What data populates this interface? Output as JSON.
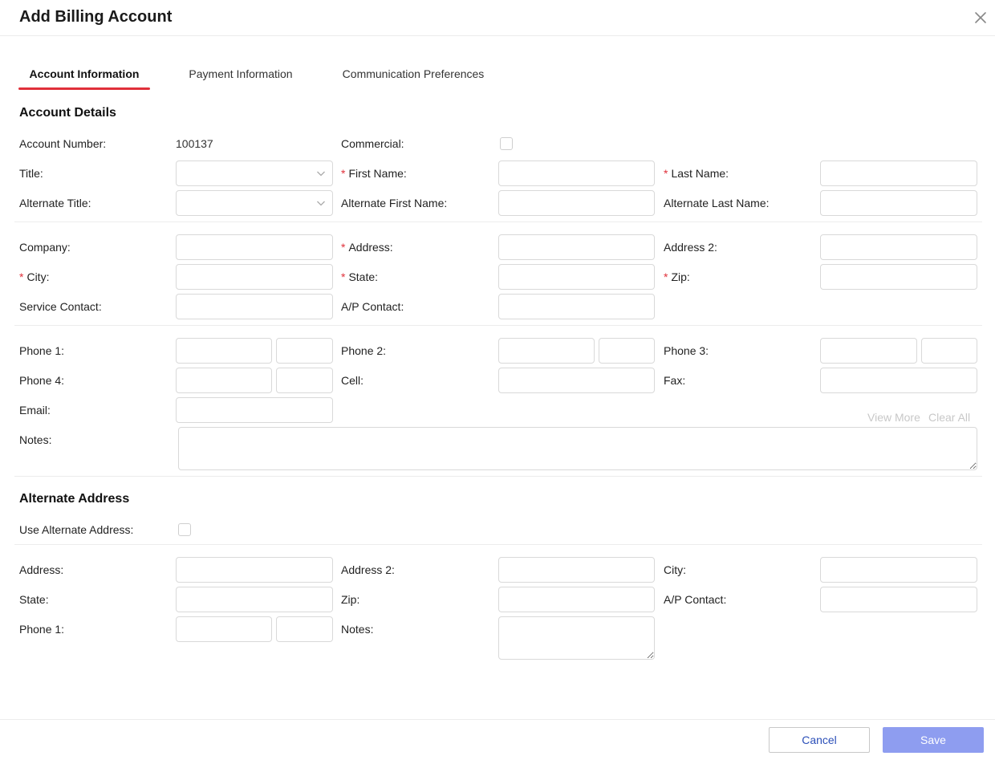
{
  "dialog": {
    "title": "Add Billing Account"
  },
  "tabs": [
    {
      "label": "Account Information",
      "active": true
    },
    {
      "label": "Payment Information",
      "active": false
    },
    {
      "label": "Communication Preferences",
      "active": false
    }
  ],
  "account_details": {
    "section_title": "Account Details",
    "account_number_label": "Account Number:",
    "account_number_value": "100137",
    "commercial_label": "Commercial:",
    "title_label": "Title:",
    "first_name_label": "First Name:",
    "last_name_label": "Last Name:",
    "alt_title_label": "Alternate Title:",
    "alt_first_name_label": "Alternate First Name:",
    "alt_last_name_label": "Alternate Last Name:",
    "company_label": "Company:",
    "address_label": "Address:",
    "address2_label": "Address 2:",
    "city_label": "City:",
    "state_label": "State:",
    "zip_label": "Zip:",
    "service_contact_label": "Service Contact:",
    "ap_contact_label": "A/P Contact:",
    "phone1_label": "Phone 1:",
    "phone2_label": "Phone 2:",
    "phone3_label": "Phone 3:",
    "phone4_label": "Phone 4:",
    "cell_label": "Cell:",
    "fax_label": "Fax:",
    "email_label": "Email:",
    "notes_label": "Notes:",
    "view_more": "View More",
    "clear_all": "Clear All",
    "required_marker": "*"
  },
  "alternate_address": {
    "section_title": "Alternate Address",
    "use_alt_label": "Use Alternate Address:",
    "address_label": "Address:",
    "address2_label": "Address 2:",
    "city_label": "City:",
    "state_label": "State:",
    "zip_label": "Zip:",
    "ap_contact_label": "A/P Contact:",
    "phone1_label": "Phone 1:",
    "notes_label": "Notes:"
  },
  "footer": {
    "cancel_label": "Cancel",
    "save_label": "Save"
  },
  "colors": {
    "accent_red": "#e0303a",
    "primary_disabled": "#8e9df0",
    "link_blue": "#2b4fb8"
  }
}
